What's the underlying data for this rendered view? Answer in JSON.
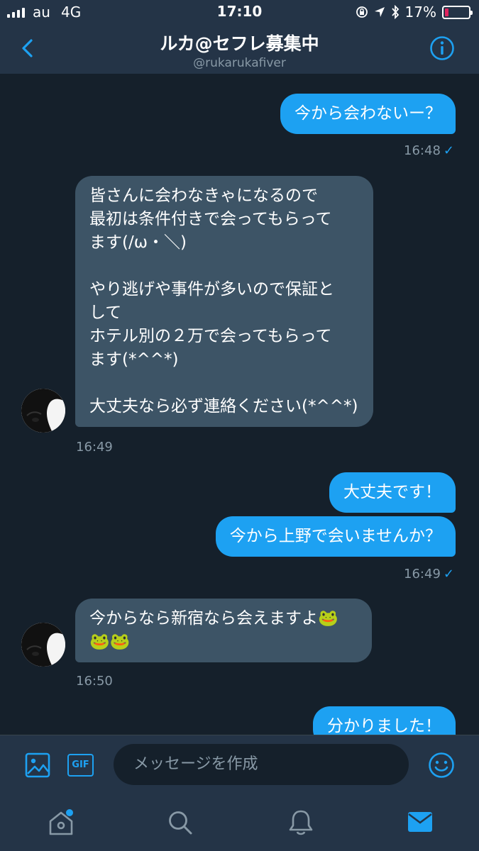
{
  "status_bar": {
    "carrier": "au",
    "network": "4G",
    "time": "17:10",
    "battery": "17%",
    "battery_level": 0.17
  },
  "header": {
    "back_icon": "chevron-left-icon",
    "title": "ルカ@セフレ募集中",
    "handle": "@rukarukafiver",
    "info_icon": "info-icon"
  },
  "messages": [
    {
      "side": "sent",
      "text": "今から会わないー？"
    },
    {
      "side": "sent_meta",
      "time": "16:48",
      "check": "✓"
    },
    {
      "side": "received",
      "text": "皆さんに会わなきゃになるので\n最初は条件付きで会ってもらって\nます(/ω・＼)\n\nやり逃げや事件が多いので保証と\nして\nホテル別の２万で会ってもらって\nます(*^^*)\n\n大丈夫なら必ず連絡ください(*^^*)"
    },
    {
      "side": "received_meta",
      "time": "16:49"
    },
    {
      "side": "sent",
      "text": "大丈夫です！"
    },
    {
      "side": "sent",
      "text": "今から上野で会いませんか？"
    },
    {
      "side": "sent_meta",
      "time": "16:49",
      "check": "✓"
    },
    {
      "side": "received",
      "text": "今からなら新宿なら会えますよ🐸\n🐸🐸"
    },
    {
      "side": "received_meta",
      "time": "16:50"
    },
    {
      "side": "sent",
      "text": "分かりました！"
    }
  ],
  "composer": {
    "image_icon": "image-icon",
    "gif_label": "GIF",
    "placeholder": "メッセージを作成",
    "emoji_icon": "emoji-icon"
  },
  "tabbar": {
    "items": [
      "home-icon",
      "search-icon",
      "notifications-icon",
      "messages-icon"
    ],
    "active": "messages-icon",
    "accent": "#1da1f2"
  },
  "colors": {
    "background": "#15202b",
    "bar": "#243447",
    "sent_bubble": "#1da1f2",
    "received_bubble": "#3d5466",
    "muted": "#8899a6"
  }
}
